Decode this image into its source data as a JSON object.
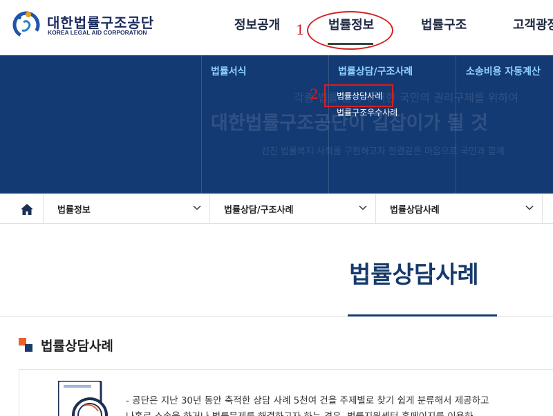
{
  "header": {
    "logo": {
      "name_ko": "대한법률구조공단",
      "name_en": "KOREA LEGAL AID CORPORATION"
    },
    "gnb": [
      "정보공개",
      "법률정보",
      "법률구조",
      "고객광장"
    ],
    "active_gnb": "법률정보"
  },
  "annotations": {
    "step1": "1",
    "step2": "2",
    "color": "#d42020"
  },
  "mega_menu": {
    "background_text": {
      "line1": "각종 법률 분쟁에 처한 국민의 권리구제를 위하여",
      "line2": "대한법률구조공단이 길잡이가 될 것",
      "line3": "선진 법률복지 사회를 구현하고자 한결같은 마음으로 국민과 함께"
    },
    "columns": [
      {
        "heading": "법률서식",
        "items": []
      },
      {
        "heading": "법률상담/구조사례",
        "items": [
          "법률상담사례",
          "법률구조우수사례"
        ]
      },
      {
        "heading": "소송비용 자동계산",
        "items": []
      }
    ],
    "color": "#143a73",
    "heading_color": "#8fd2ff"
  },
  "breadcrumb": {
    "home_icon": "home-icon",
    "items": [
      "법률정보",
      "법률상담/구조사례",
      "법률상담사례"
    ]
  },
  "page": {
    "title": "법률상담사례",
    "section_title": "법률상담사례",
    "description": [
      "- 공단은 지난 30년 동안 축적한 상담 사례 5천여 건을 주제별로 찾기 쉽게 분류해서 제공하고",
      "나홀로 소송을 하거나 법률문제를 해결하고자 하는 경우, 법률지원센터 홈페이지를 이용하"
    ],
    "accent_color": "#163a6b"
  }
}
